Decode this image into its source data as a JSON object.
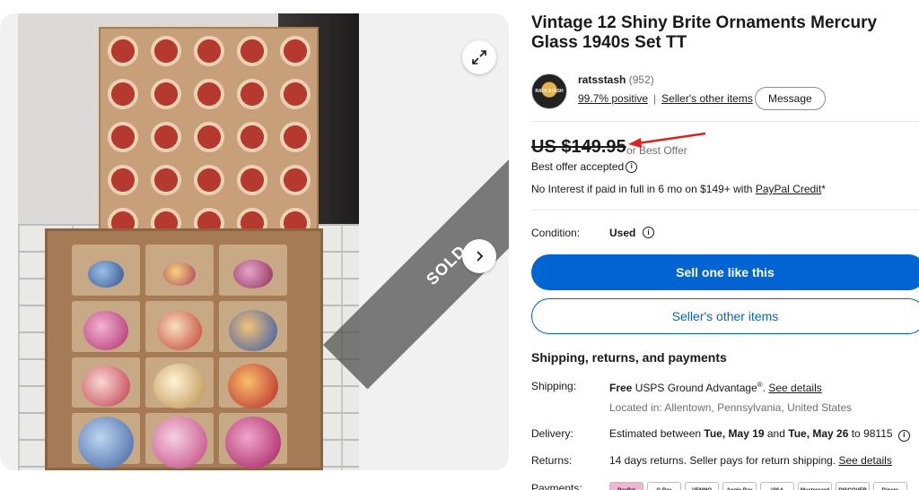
{
  "listing": {
    "title": "Vintage 12 Shiny Brite Ornaments Mercury Glass 1940s Set TT",
    "sold_label": "SOLD"
  },
  "seller": {
    "name": "ratsstash",
    "feedback_count": "(952)",
    "positive": "99.7% positive",
    "other_items_link": "Seller's other items",
    "message_button": "Message",
    "avatar_text": "RATS STASH"
  },
  "price": {
    "amount": "US $149.95",
    "best_offer": "or Best Offer",
    "accepted": "Best offer accepted",
    "financing_prefix": "No Interest if paid in full in 6 mo on $149+ with ",
    "financing_link": "PayPal Credit",
    "financing_suffix": "*"
  },
  "condition": {
    "label": "Condition:",
    "value": "Used"
  },
  "actions": {
    "primary": "Sell one like this",
    "secondary": "Seller's other items"
  },
  "shipping": {
    "section_title": "Shipping, returns, and payments",
    "shipping_label": "Shipping:",
    "shipping_free": "Free",
    "shipping_service": " USPS Ground Advantage",
    "shipping_reg": "®",
    "shipping_link": "See details",
    "location": "Located in: Allentown, Pennsylvania, United States",
    "delivery_label": "Delivery:",
    "delivery_prefix": "Estimated between ",
    "delivery_start": "Tue, May 19",
    "delivery_and": " and ",
    "delivery_end": "Tue, May 26",
    "delivery_suffix": " to 98115",
    "returns_label": "Returns:",
    "returns_text": "14 days returns. Seller pays for return shipping. ",
    "returns_link": "See details",
    "payments_label": "Payments:",
    "payment_methods": [
      "PayPal",
      "G Pay",
      "VENMO",
      "Apple Pay",
      "VISA",
      "Mastercard",
      "DISCOVER",
      "Diners"
    ]
  },
  "colors": {
    "accent": "#0064d2",
    "annotation_arrow": "#e0201b"
  },
  "icons": {
    "expand": "expand-icon",
    "next": "chevron-right-icon",
    "info": "info-icon"
  }
}
